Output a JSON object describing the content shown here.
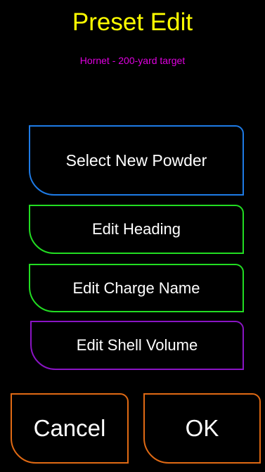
{
  "header": {
    "title": "Preset Edit",
    "subtitle": "Hornet - 200-yard target"
  },
  "menu": {
    "select_powder_label": "Select New Powder",
    "edit_heading_label": "Edit Heading",
    "edit_charge_name_label": "Edit Charge Name",
    "edit_shell_volume_label": "Edit Shell Volume"
  },
  "footer": {
    "cancel_label": "Cancel",
    "ok_label": "OK"
  },
  "colors": {
    "background": "#000000",
    "title": "#ffff00",
    "subtitle": "#e000e0",
    "select_powder_border": "#1e7be6",
    "edit_border": "#22dd22",
    "shell_volume_border": "#8a14c4",
    "footer_border": "#e06a14",
    "button_text": "#ffffff"
  }
}
